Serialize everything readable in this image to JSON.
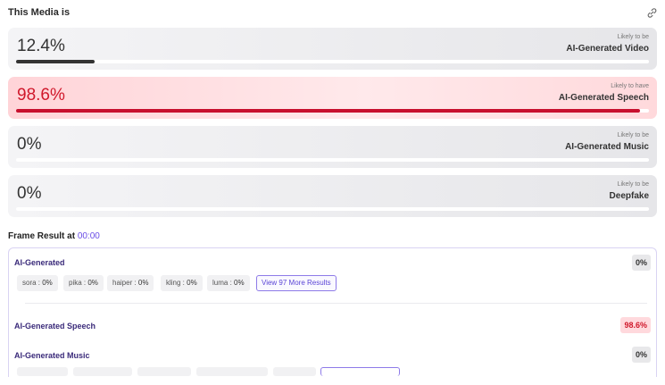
{
  "header": {
    "title": "This Media is",
    "icon": "link-icon"
  },
  "cards": [
    {
      "percent": "12.4%",
      "likely": "Likely to be",
      "kind": "AI-Generated Video",
      "value": 0.124,
      "variant": "grey"
    },
    {
      "percent": "98.6%",
      "likely": "Likely to have",
      "kind": "AI-Generated Speech",
      "value": 0.986,
      "variant": "red"
    },
    {
      "percent": "0%",
      "likely": "Likely to be",
      "kind": "AI-Generated Music",
      "value": 0,
      "variant": "grey"
    },
    {
      "percent": "0%",
      "likely": "Likely to be",
      "kind": "Deepfake",
      "value": 0,
      "variant": "grey"
    }
  ],
  "frame": {
    "label": "Frame Result at",
    "time": "00:00"
  },
  "results": {
    "ai_generated": {
      "title": "AI-Generated",
      "badge": "0%",
      "models": [
        {
          "name": "sora",
          "value": "0%"
        },
        {
          "name": "pika",
          "value": "0%"
        },
        {
          "name": "haiper",
          "value": "0%"
        },
        {
          "name": "kling",
          "value": "0%"
        },
        {
          "name": "luma",
          "value": "0%"
        }
      ],
      "more_button": "View 97 More Results"
    },
    "speech": {
      "title": "AI-Generated Speech",
      "badge": "98.6%"
    },
    "music": {
      "title": "AI-Generated Music",
      "badge": "0%"
    }
  },
  "colors": {
    "accent": "#6a4de6",
    "alert": "#d0182b",
    "bar_dark": "#333333"
  }
}
